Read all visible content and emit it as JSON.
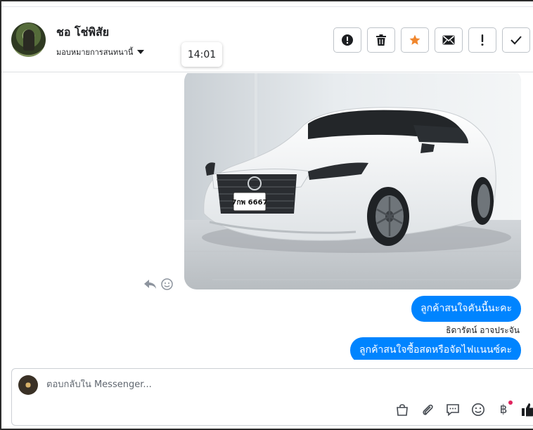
{
  "header": {
    "contact_name": "ชอ โช่พิสัย",
    "assign_label": "มอบหมายการสนทนานี้",
    "tooltip_time": "14:01",
    "actions": [
      {
        "name": "mark-spam-button",
        "icon": "alert-circle-icon"
      },
      {
        "name": "delete-button",
        "icon": "trash-icon"
      },
      {
        "name": "star-button",
        "icon": "star-icon",
        "color": "#f0862d"
      },
      {
        "name": "mark-unread-button",
        "icon": "envelope-icon"
      },
      {
        "name": "follow-up-button",
        "icon": "exclamation-icon"
      },
      {
        "name": "done-button",
        "icon": "check-icon"
      }
    ]
  },
  "conversation": {
    "photo": {
      "plate_text": "7กพ 6667"
    },
    "messages": [
      {
        "text": "ลูกค้าสนใจคันนี้นะคะ"
      },
      {
        "text": "ลูกค้าสนใจซื้อสดหรือจัดไฟแนนซ์คะ"
      }
    ],
    "sender_name": "ธิดารัตน์ อาจประจัน"
  },
  "composer": {
    "placeholder": "ตอบกลับใน Messenger...",
    "tools": [
      "shopping-bag-icon",
      "paperclip-icon",
      "saved-reply-icon",
      "emoji-icon",
      "baht-icon",
      "thumbs-up-icon"
    ],
    "baht_symbol": "฿"
  },
  "colors": {
    "accent": "#0084ff",
    "star": "#f0862d",
    "border": "#bec3c9"
  }
}
